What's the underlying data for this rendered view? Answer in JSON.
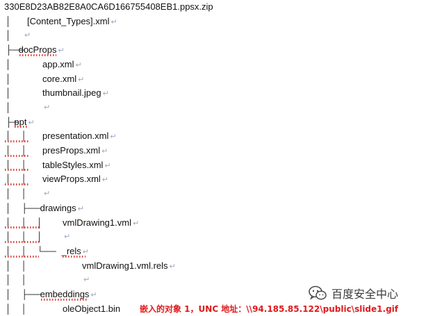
{
  "paragraph_mark": "↵",
  "lines": [
    {
      "prefix": "",
      "name": "330E8D23AB82E8A0CA6D166755408EB1.ppsx.zip",
      "indent": 6,
      "squiggle": false,
      "mark": false
    },
    {
      "prefix": "│    ",
      "name": "[Content_Types].xml",
      "indent": 6,
      "squiggle": false,
      "mark": true
    },
    {
      "prefix": "│",
      "name": "",
      "indent": 6,
      "squiggle": false,
      "mark": true
    },
    {
      "prefix": "├──",
      "name": "docProps",
      "indent": 6,
      "squiggle": true,
      "mark": true
    },
    {
      "prefix": "│",
      "name": "app.xml",
      "indent": 6,
      "squiggle": false,
      "mark": true,
      "nameX": 61
    },
    {
      "prefix": "│",
      "name": "core.xml",
      "indent": 6,
      "squiggle": false,
      "mark": true,
      "nameX": 61
    },
    {
      "prefix": "│",
      "name": "thumbnail.jpeg",
      "indent": 6,
      "squiggle": false,
      "mark": true,
      "nameX": 61
    },
    {
      "prefix": "│",
      "name": "",
      "indent": 6,
      "squiggle": false,
      "mark": true,
      "markX": 61
    },
    {
      "prefix": "├─",
      "name": "ppt",
      "indent": 6,
      "squiggle": true,
      "mark": true
    },
    {
      "prefix": "│    │",
      "name": "presentation.xml",
      "indent": 6,
      "squiggle": false,
      "mark": true,
      "nameX": 61,
      "prefixSq": true
    },
    {
      "prefix": "│    │",
      "name": "presProps.xml",
      "indent": 6,
      "squiggle": false,
      "mark": true,
      "nameX": 61,
      "prefixSq": true
    },
    {
      "prefix": "│    │",
      "name": "tableStyles.xml",
      "indent": 6,
      "squiggle": false,
      "mark": true,
      "nameX": 61,
      "prefixSq": true
    },
    {
      "prefix": "│    │",
      "name": "viewProps.xml",
      "indent": 6,
      "squiggle": false,
      "mark": true,
      "nameX": 61,
      "prefixSq": true
    },
    {
      "prefix": "│    │",
      "name": "",
      "indent": 6,
      "squiggle": false,
      "mark": true,
      "markX": 61
    },
    {
      "prefix": "│    ├──",
      "name": "drawings",
      "indent": 6,
      "squiggle": false,
      "mark": true
    },
    {
      "prefix": "│    │    │",
      "name": "vmlDrawing1.vml",
      "indent": 6,
      "squiggle": false,
      "mark": true,
      "nameX": 90,
      "prefixSq": true
    },
    {
      "prefix": "│    │    │",
      "name": "",
      "indent": 6,
      "squiggle": false,
      "mark": true,
      "markX": 90,
      "prefixSq": true
    },
    {
      "prefix": "│    │    └──",
      "name": "_rels",
      "indent": 6,
      "squiggle": true,
      "mark": true,
      "prefixSq": true
    },
    {
      "prefix": "│    │",
      "name": "vmlDrawing1.vml.rels",
      "indent": 6,
      "squiggle": false,
      "mark": true,
      "nameX": 118
    },
    {
      "prefix": "│    │",
      "name": "",
      "indent": 6,
      "squiggle": false,
      "mark": true,
      "markX": 118
    },
    {
      "prefix": "│    ├──",
      "name": "embeddings",
      "indent": 6,
      "squiggle": true,
      "mark": true
    },
    {
      "prefix": "│    │",
      "name": "oleObject1.bin",
      "indent": 6,
      "squiggle": false,
      "mark": false,
      "nameX": 90
    }
  ],
  "annotation": "嵌入的对象 1，UNC 地址：\\\\94.185.85.122\\public\\slide1.gif",
  "watermark": {
    "icon": "wechat-icon",
    "text": "百度安全中心"
  },
  "colors": {
    "squiggle": "#d9302b",
    "annotation": "#e0191b",
    "mark": "#9aa8c0"
  }
}
